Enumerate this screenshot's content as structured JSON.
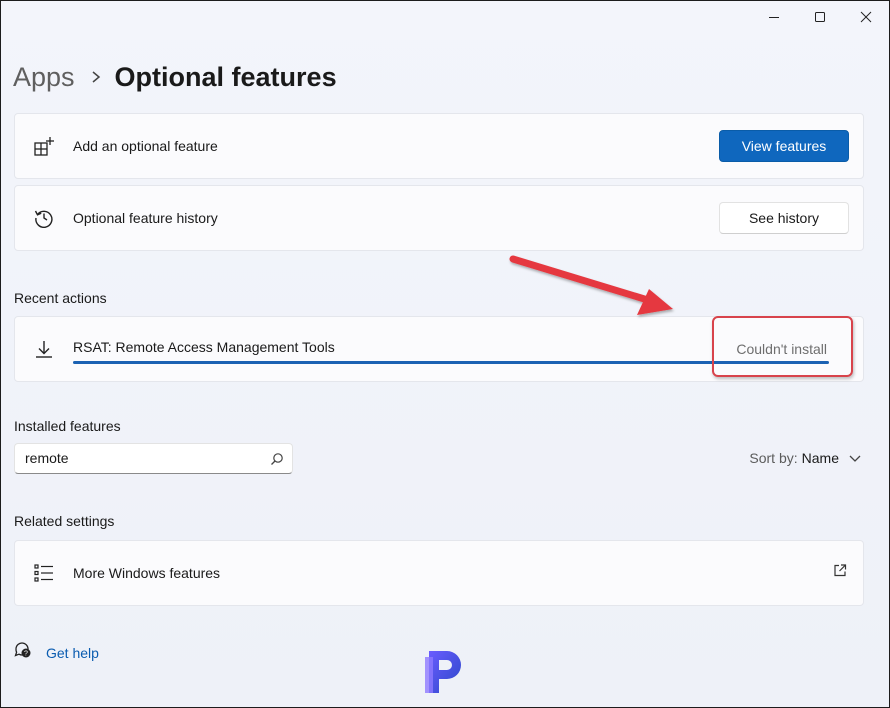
{
  "window": {
    "caption": {
      "minimize_icon": "minimize-icon",
      "maximize_icon": "maximize-icon",
      "close_icon": "close-icon"
    }
  },
  "breadcrumb": {
    "parent": "Apps",
    "separator_icon": "chevron-right-icon",
    "current": "Optional features"
  },
  "add_feature": {
    "icon": "add-feature-icon",
    "label": "Add an optional feature",
    "button": "View features"
  },
  "history": {
    "icon": "history-icon",
    "label": "Optional feature history",
    "button": "See history"
  },
  "recent_actions": {
    "title": "Recent actions",
    "items": [
      {
        "icon": "download-icon",
        "label": "RSAT: Remote Access Management Tools",
        "status": "Couldn't install",
        "progress": 1.0
      }
    ]
  },
  "installed_features": {
    "title": "Installed features",
    "search_value": "remote",
    "sort_label": "Sort by:",
    "sort_value": "Name"
  },
  "related_settings": {
    "title": "Related settings",
    "items": [
      {
        "icon": "list-icon",
        "label": "More Windows features",
        "trailing_icon": "open-external-icon"
      }
    ]
  },
  "help": {
    "icon": "help-chat-icon",
    "label": "Get help"
  },
  "annotation": {
    "arrow_color": "#e5393f",
    "box_color": "#d8434b"
  },
  "colors": {
    "accent": "#0f67be"
  }
}
